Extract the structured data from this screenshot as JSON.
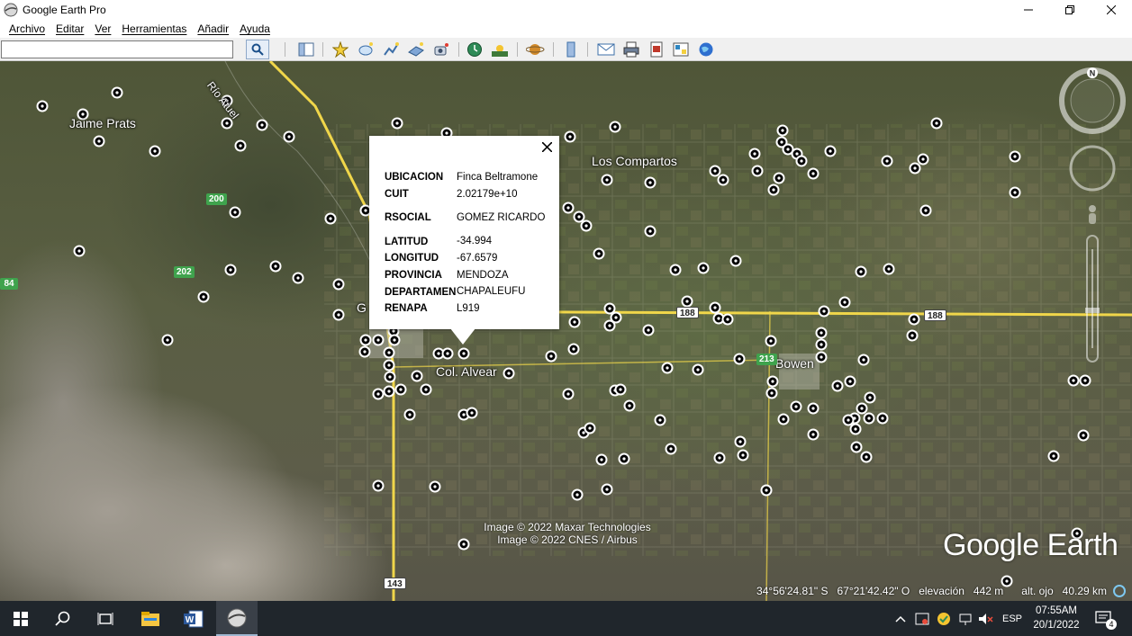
{
  "window": {
    "title": "Google Earth Pro",
    "icon": "google-earth-icon"
  },
  "menu": {
    "items": [
      "Archivo",
      "Editar",
      "Ver",
      "Herramientas",
      "Añadir",
      "Ayuda"
    ]
  },
  "toolbar": {
    "search_value": "",
    "tools": [
      "search-icon",
      "sidebar-toggle-icon",
      "placemark-icon",
      "polygon-icon",
      "path-icon",
      "image-overlay-icon",
      "record-tour-icon",
      "historical-imagery-icon",
      "sunlight-icon",
      "planets-icon",
      "ruler-icon",
      "email-icon",
      "print-icon",
      "save-image-icon",
      "view-in-maps-icon",
      "earth-icon"
    ]
  },
  "map": {
    "places": [
      {
        "label": "Jaime Prats"
      },
      {
        "label": "Los Compartos"
      },
      {
        "label": "Col. Alvear"
      },
      {
        "label": "Bowen"
      },
      {
        "label": "G"
      },
      {
        "label": "Río Atuel"
      }
    ],
    "road_shields": [
      "200",
      "202",
      "84",
      "188",
      "188",
      "213",
      "143"
    ],
    "attribution": [
      "Image © 2022 Maxar Technologies",
      "Image © 2022 CNES / Airbus"
    ],
    "brand": "Google Earth",
    "status": {
      "lat": "34°56'24.81\" S",
      "lon": "67°21'42.42\" O",
      "elevation_label": "elevación",
      "elevation_value": "442 m",
      "eye_label": "alt. ojo",
      "eye_value": "40.29 km"
    },
    "colors": {
      "road": "#f0d64a",
      "marker_ring": "#ffffff",
      "marker_center": "#000000"
    }
  },
  "popup": {
    "rows": [
      {
        "key": "UBICACION",
        "value": "Finca Beltramone"
      },
      {
        "key": "CUIT",
        "value": "2.02179e+10"
      },
      {
        "key": "RSOCIAL",
        "value": "GOMEZ RICARDO"
      },
      {
        "key": "LATITUD",
        "value": "-34.994"
      },
      {
        "key": "LONGITUD",
        "value": "-67.6579"
      },
      {
        "key": "PROVINCIA",
        "value": "MENDOZA"
      },
      {
        "key": "DEPARTAMEN",
        "value": "CHAPALEUFU"
      },
      {
        "key": "RENAPA",
        "value": "L919"
      }
    ]
  },
  "taskbar": {
    "apps": [
      "windows-start-icon",
      "search-icon",
      "task-view-icon",
      "file-explorer-icon",
      "word-icon",
      "google-earth-icon"
    ],
    "language": "ESP",
    "time": "07:55AM",
    "date": "20/1/2022",
    "notifications": "4"
  }
}
